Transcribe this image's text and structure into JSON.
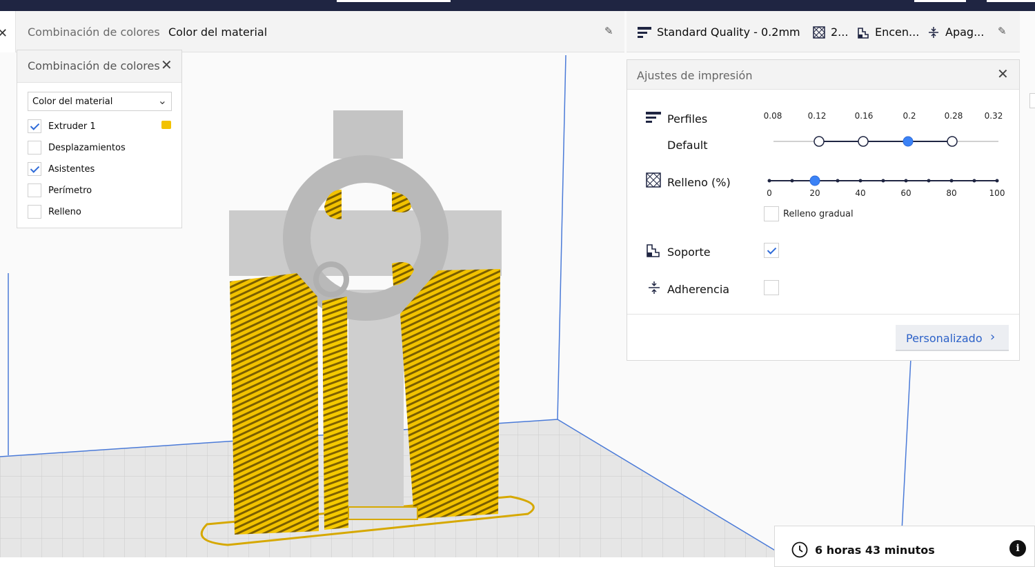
{
  "header_left": {
    "color_scheme_label": "Combinación de colores",
    "color_scheme_value": "Color del material"
  },
  "header_right": {
    "quality": "Standard Quality - 0.2mm",
    "infill_short": "2...",
    "support_short": "Encen...",
    "adhesion_short": "Apag..."
  },
  "color_panel": {
    "title": "Combinación de colores",
    "dropdown_value": "Color del material",
    "items": [
      {
        "label": "Extruder 1",
        "checked": true
      },
      {
        "label": "Desplazamientos",
        "checked": false
      },
      {
        "label": "Asistentes",
        "checked": true
      },
      {
        "label": "Perímetro",
        "checked": false
      },
      {
        "label": "Relleno",
        "checked": false
      }
    ],
    "extruder_color": "#f2c200"
  },
  "print_settings": {
    "title": "Ajustes de impresión",
    "profiles_label": "Perfiles",
    "profile_name": "Default",
    "layer_heights": [
      "0.08",
      "0.12",
      "0.16",
      "0.2",
      "0.28",
      "0.32"
    ],
    "selected_layer_height": "0.2",
    "infill_label": "Relleno (%)",
    "infill_ticks": [
      "0",
      "20",
      "40",
      "60",
      "80",
      "100"
    ],
    "infill_value": 20,
    "gradual_infill_label": "Relleno gradual",
    "gradual_infill_checked": false,
    "support_label": "Soporte",
    "support_checked": true,
    "adhesion_label": "Adherencia",
    "adhesion_checked": false,
    "custom_button": "Personalizado"
  },
  "print_time": "6 horas 43 minutos",
  "colors": {
    "accent_blue": "#3b82f6",
    "slider_navy": "#1f2542",
    "model_yellow": "#f2c200",
    "annotation_red": "#ff0000"
  }
}
